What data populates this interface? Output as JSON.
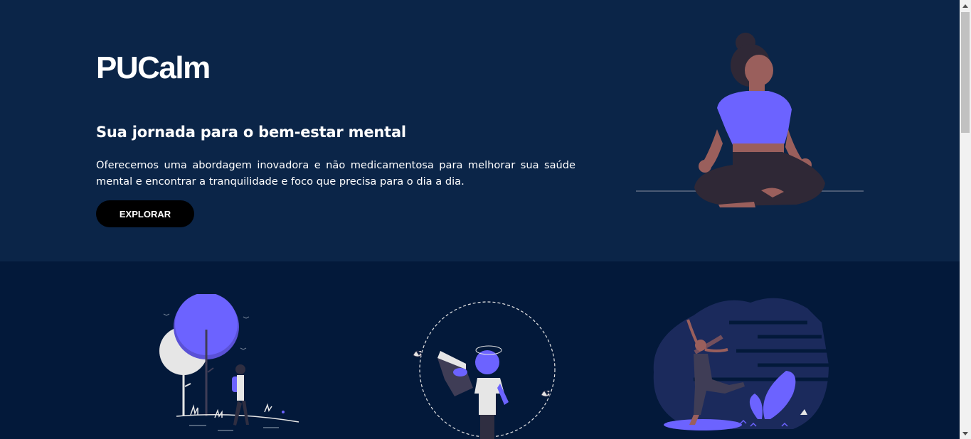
{
  "brand": {
    "logo_text": "PUCalm"
  },
  "hero": {
    "headline": "Sua jornada para o bem-estar mental",
    "description": "Oferecemos uma abordagem inovadora e não medicamentosa para melhorar sua saúde mental e encontrar a tranquilidade e foco que precisa para o dia a dia.",
    "cta_label": "EXPLORAR",
    "illustration": "meditation-illustration"
  },
  "features": {
    "illustrations": [
      "walking-in-nature-illustration",
      "reading-book-illustration",
      "dancing-joy-illustration"
    ]
  },
  "colors": {
    "hero_bg": "#0b2548",
    "page_bg": "#03193a",
    "accent": "#6c63ff",
    "button_bg": "#000000",
    "text": "#ffffff"
  }
}
